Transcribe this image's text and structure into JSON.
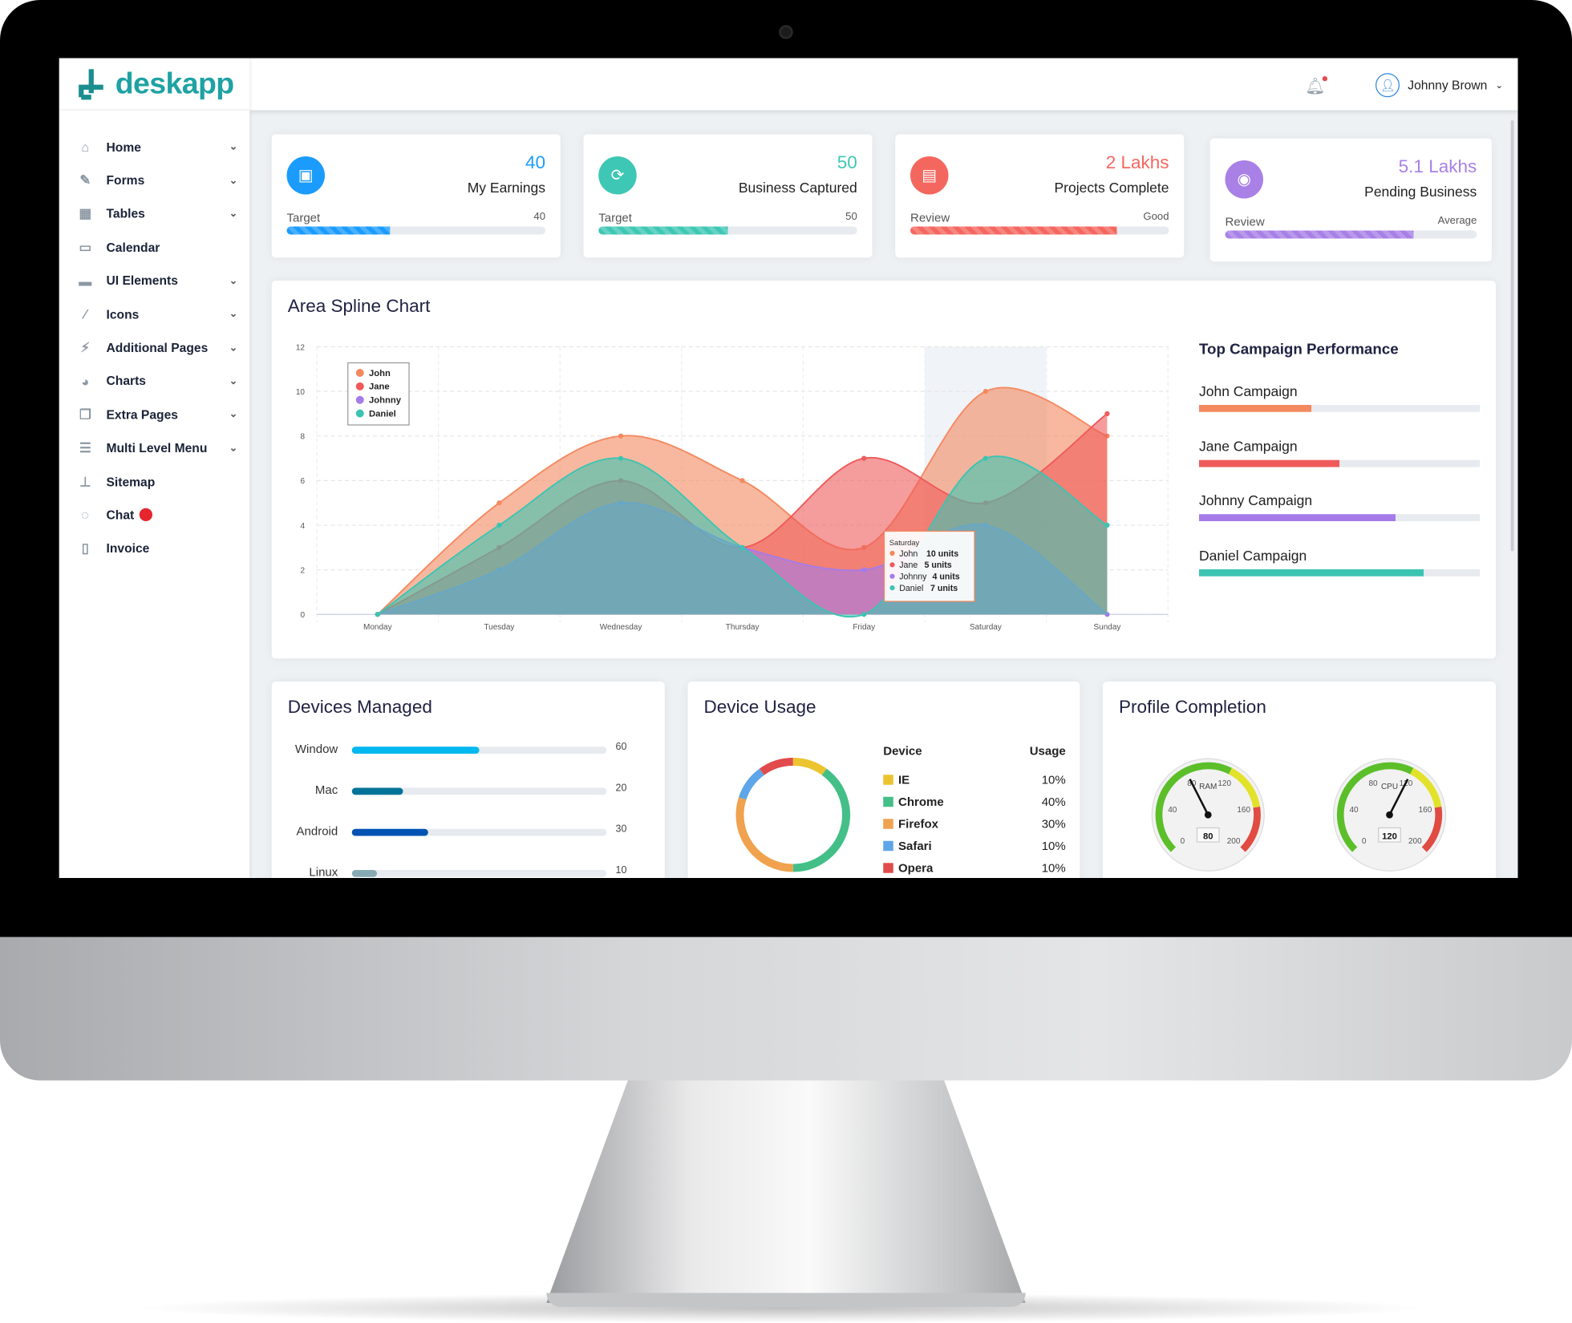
{
  "app": {
    "logo": "deskapp"
  },
  "header": {
    "user_name": "Johnny Brown",
    "has_notification": true
  },
  "sidebar": {
    "items": [
      {
        "label": "Home",
        "icon": "home-icon",
        "expandable": true
      },
      {
        "label": "Forms",
        "icon": "pencil-icon",
        "expandable": true
      },
      {
        "label": "Tables",
        "icon": "table-icon",
        "expandable": true
      },
      {
        "label": "Calendar",
        "icon": "calendar-icon",
        "expandable": false
      },
      {
        "label": "UI Elements",
        "icon": "desktop-icon",
        "expandable": true
      },
      {
        "label": "Icons",
        "icon": "paintbrush-icon",
        "expandable": true
      },
      {
        "label": "Additional Pages",
        "icon": "plug-icon",
        "expandable": true
      },
      {
        "label": "Charts",
        "icon": "pie-chart-icon",
        "expandable": true
      },
      {
        "label": "Extra Pages",
        "icon": "copy-icon",
        "expandable": true
      },
      {
        "label": "Multi Level Menu",
        "icon": "list-icon",
        "expandable": true
      },
      {
        "label": "Sitemap",
        "icon": "sitemap-icon",
        "expandable": false
      },
      {
        "label": "Chat",
        "icon": "chat-icon",
        "expandable": false,
        "badge": "new"
      },
      {
        "label": "Invoice",
        "icon": "map-icon",
        "expandable": false
      }
    ]
  },
  "stats": [
    {
      "value": "40",
      "label": "My Earnings",
      "progress_label": "Target",
      "progress_value": "40",
      "progress": 40,
      "color": "#1b9cfc",
      "icon": "briefcase-icon"
    },
    {
      "value": "50",
      "label": "Business Captured",
      "progress_label": "Target",
      "progress_value": "50",
      "progress": 50,
      "color": "#3ec7b4",
      "icon": "handshake-icon"
    },
    {
      "value": "2 Lakhs",
      "label": "Projects Complete",
      "progress_label": "Review",
      "progress_value": "Good",
      "progress": 80,
      "color": "#f4675f",
      "icon": "list-icon"
    },
    {
      "value": "5.1 Lakhs",
      "label": "Pending Business",
      "progress_label": "Review",
      "progress_value": "Average",
      "progress": 75,
      "color": "#a880e6",
      "icon": "podcast-icon"
    }
  ],
  "area_chart": {
    "title": "Area Spline Chart",
    "tooltip": {
      "title": "Saturday",
      "rows": [
        {
          "name": "John",
          "value": "10 units"
        },
        {
          "name": "Jane",
          "value": "5 units"
        },
        {
          "name": "Johnny",
          "value": "4 units"
        },
        {
          "name": "Daniel",
          "value": "7 units"
        }
      ]
    }
  },
  "chart_data": [
    {
      "type": "area",
      "title": "Area Spline Chart",
      "categories": [
        "Monday",
        "Tuesday",
        "Wednesday",
        "Thursday",
        "Friday",
        "Saturday",
        "Sunday"
      ],
      "ylim": [
        0,
        12
      ],
      "yticks": [
        0,
        2,
        4,
        6,
        8,
        10,
        12
      ],
      "grid": true,
      "legend": "top-left",
      "series": [
        {
          "name": "John",
          "color": "#f4895f",
          "values": [
            0,
            5,
            8,
            6,
            3,
            10,
            8
          ]
        },
        {
          "name": "Jane",
          "color": "#ef5a5a",
          "values": [
            0,
            3,
            6,
            3,
            7,
            5,
            9
          ]
        },
        {
          "name": "Johnny",
          "color": "#a57bea",
          "values": [
            0,
            2,
            5,
            3,
            2,
            4,
            0
          ]
        },
        {
          "name": "Daniel",
          "color": "#3cc4b2",
          "values": [
            0,
            4,
            7,
            3,
            0,
            7,
            4
          ]
        }
      ]
    },
    {
      "type": "bar",
      "title": "Top Campaign Performance",
      "categories": [
        "John Campaign",
        "Jane Campaign",
        "Johnny Campaign",
        "Daniel Campaign"
      ],
      "values": [
        40,
        50,
        70,
        80
      ],
      "colors": [
        "#f4895f",
        "#ef5a5a",
        "#a57bea",
        "#3cc4b2"
      ]
    },
    {
      "type": "bar",
      "title": "Devices Managed",
      "categories": [
        "Window",
        "Mac",
        "Android",
        "Linux"
      ],
      "values": [
        60,
        20,
        30,
        10
      ],
      "labels": [
        "60",
        "20",
        "30",
        "10"
      ],
      "fill": [
        50,
        20,
        30,
        10
      ],
      "colors": [
        "#00b8f0",
        "#007498",
        "#0053b3",
        "#87abb4"
      ]
    },
    {
      "type": "pie",
      "title": "Device Usage",
      "legend_headers": [
        "Device",
        "Usage"
      ],
      "categories": [
        "IE",
        "Chrome",
        "Firefox",
        "Safari",
        "Opera"
      ],
      "values": [
        10,
        40,
        30,
        10,
        10
      ],
      "labels": [
        "10%",
        "40%",
        "30%",
        "10%",
        "10%"
      ],
      "colors": [
        "#ecc430",
        "#43bf87",
        "#f0a24e",
        "#5fa6e8",
        "#e14b4b"
      ]
    }
  ],
  "profile": {
    "title": "Profile Completion",
    "gauges": [
      {
        "label": "RAM",
        "value": 80
      },
      {
        "label": "CPU",
        "value": 120
      }
    ],
    "min": 0,
    "max": 200,
    "ticks": [
      "0",
      "40",
      "80",
      "120",
      "160",
      "200"
    ]
  }
}
